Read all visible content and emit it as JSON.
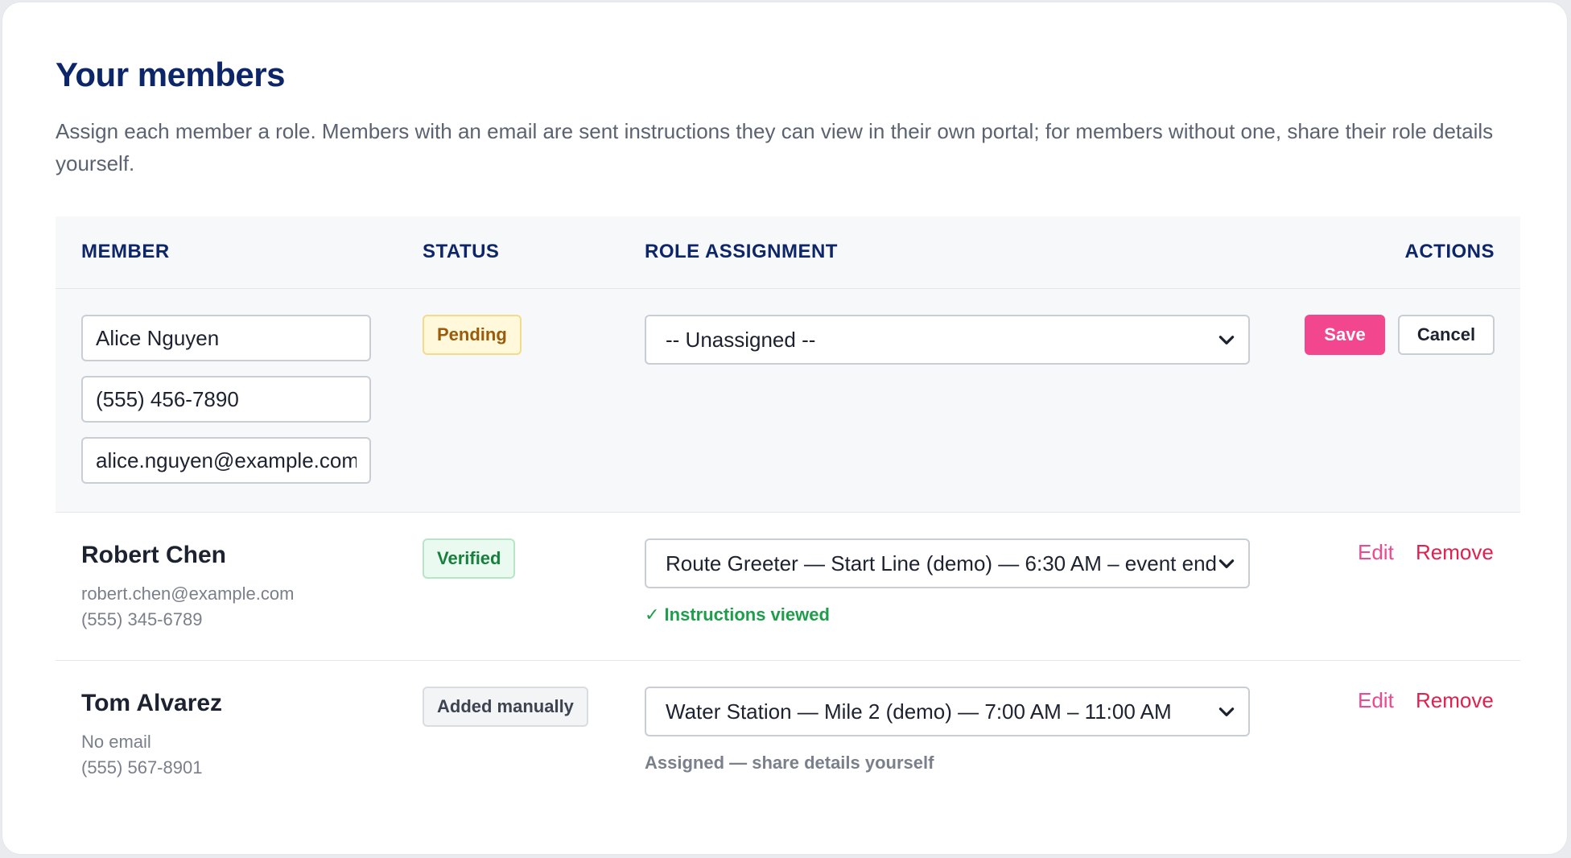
{
  "header": {
    "title": "Your members",
    "description": "Assign each member a role. Members with an email are sent instructions they can view in their own portal; for members without one, share their role details yourself."
  },
  "table": {
    "columns": {
      "member": "MEMBER",
      "status": "STATUS",
      "role": "ROLE ASSIGNMENT",
      "actions": "ACTIONS"
    }
  },
  "editing_row": {
    "name_value": "Alice Nguyen",
    "phone_value": "(555) 456-7890",
    "email_value": "alice.nguyen@example.com",
    "status": "Pending",
    "role_selected": "-- Unassigned --",
    "save_label": "Save",
    "cancel_label": "Cancel"
  },
  "members": [
    {
      "name": "Robert Chen",
      "email": "robert.chen@example.com",
      "phone": "(555) 345-6789",
      "status": "Verified",
      "role_selected": "Route Greeter — Start Line (demo) — 6:30 AM – event end",
      "note": "✓ Instructions viewed",
      "edit_label": "Edit",
      "remove_label": "Remove"
    },
    {
      "name": "Tom Alvarez",
      "email": "No email",
      "phone": "(555) 567-8901",
      "status": "Added manually",
      "role_selected": "Water Station — Mile 2 (demo) — 7:00 AM – 11:00 AM",
      "note": "Assigned — share details yourself",
      "edit_label": "Edit",
      "remove_label": "Remove"
    }
  ],
  "icons": {
    "select_chevron": "chevron-down-icon"
  },
  "colors": {
    "title": "#0d2569",
    "accent_pink": "#f2478f",
    "danger": "#e2204d",
    "success": "#1e9e4a"
  }
}
